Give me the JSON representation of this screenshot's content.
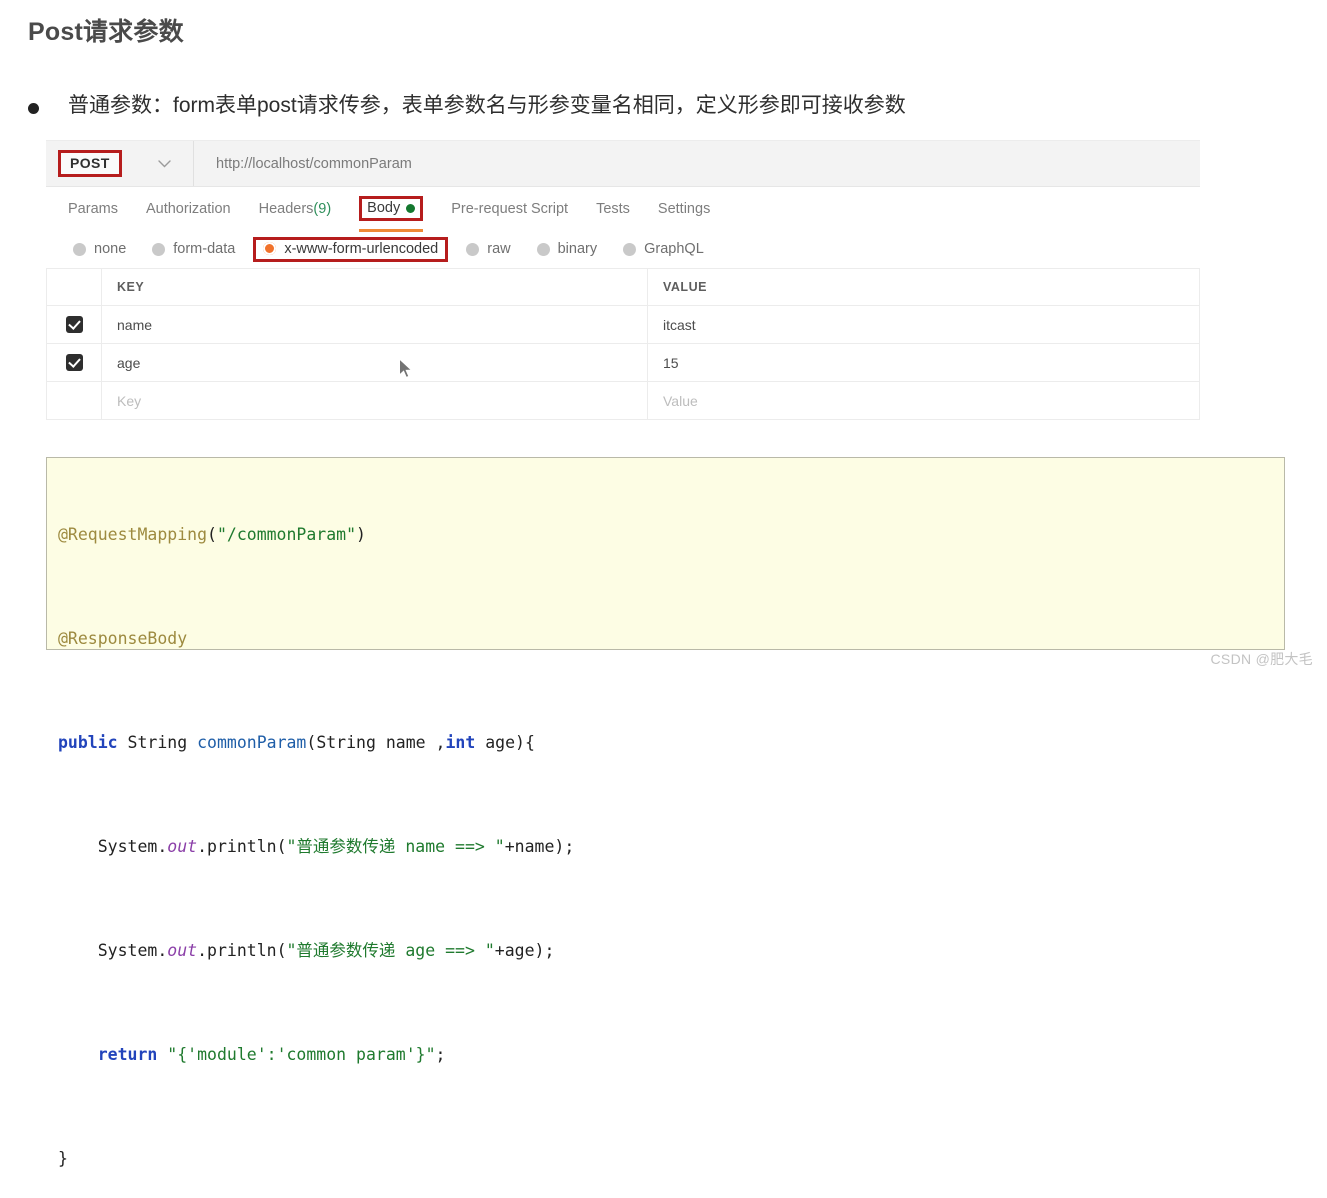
{
  "page": {
    "title": "Post请求参数",
    "bullet": "普通参数：form表单post请求传参，表单参数名与形参变量名相同，定义形参即可接收参数",
    "watermark": "CSDN @肥大毛"
  },
  "postman": {
    "method": "POST",
    "method_caret": "chevron-down",
    "url": "http://localhost/commonParam",
    "tabs": [
      {
        "label": "Params",
        "active": false,
        "boxed": false
      },
      {
        "label": "Authorization",
        "active": false,
        "boxed": false
      },
      {
        "label": "Headers ",
        "count": "(9)",
        "active": false,
        "boxed": false
      },
      {
        "label": "Body",
        "active": true,
        "boxed": true,
        "dot": true
      },
      {
        "label": "Pre-request Script",
        "active": false,
        "boxed": false
      },
      {
        "label": "Tests",
        "active": false,
        "boxed": false
      },
      {
        "label": "Settings",
        "active": false,
        "boxed": false
      }
    ],
    "body_types": [
      {
        "label": "none",
        "selected": false,
        "boxed": false
      },
      {
        "label": "form-data",
        "selected": false,
        "boxed": false
      },
      {
        "label": "x-www-form-urlencoded",
        "selected": true,
        "boxed": true
      },
      {
        "label": "raw",
        "selected": false,
        "boxed": false
      },
      {
        "label": "binary",
        "selected": false,
        "boxed": false
      },
      {
        "label": "GraphQL",
        "selected": false,
        "boxed": false
      }
    ],
    "table": {
      "headers": {
        "key": "KEY",
        "value": "VALUE"
      },
      "rows": [
        {
          "checked": true,
          "key": "name",
          "value": "itcast",
          "placeholder": false
        },
        {
          "checked": true,
          "key": "age",
          "value": "15",
          "placeholder": false
        },
        {
          "checked": false,
          "key": "Key",
          "value": "Value",
          "placeholder": true
        }
      ]
    }
  },
  "code": {
    "lines": [
      {
        "tokens": [
          {
            "t": "@RequestMapping",
            "c": "ann"
          },
          {
            "t": "(",
            "c": "plain"
          },
          {
            "t": "\"/commonParam\"",
            "c": "str"
          },
          {
            "t": ")",
            "c": "plain"
          }
        ]
      },
      {
        "tokens": [
          {
            "t": "@ResponseBody",
            "c": "ann"
          }
        ]
      },
      {
        "tokens": [
          {
            "t": "public",
            "c": "kw"
          },
          {
            "t": " ",
            "c": "plain"
          },
          {
            "t": "String",
            "c": "type"
          },
          {
            "t": " ",
            "c": "plain"
          },
          {
            "t": "commonParam",
            "c": "fn"
          },
          {
            "t": "(",
            "c": "plain"
          },
          {
            "t": "String",
            "c": "type"
          },
          {
            "t": " name ,",
            "c": "plain"
          },
          {
            "t": "int",
            "c": "kw"
          },
          {
            "t": " age){",
            "c": "plain"
          }
        ]
      },
      {
        "tokens": [
          {
            "t": "    System.",
            "c": "plain"
          },
          {
            "t": "out",
            "c": "field"
          },
          {
            "t": ".println(",
            "c": "plain"
          },
          {
            "t": "\"普通参数传递 name ==> \"",
            "c": "str"
          },
          {
            "t": "+name);",
            "c": "plain"
          }
        ]
      },
      {
        "tokens": [
          {
            "t": "    System.",
            "c": "plain"
          },
          {
            "t": "out",
            "c": "field"
          },
          {
            "t": ".println(",
            "c": "plain"
          },
          {
            "t": "\"普通参数传递 age ==> \"",
            "c": "str"
          },
          {
            "t": "+age);",
            "c": "plain"
          }
        ]
      },
      {
        "tokens": [
          {
            "t": "    ",
            "c": "plain"
          },
          {
            "t": "return",
            "c": "kw"
          },
          {
            "t": " ",
            "c": "plain"
          },
          {
            "t": "\"{'module':'common param'}\"",
            "c": "str"
          },
          {
            "t": ";",
            "c": "plain"
          }
        ]
      },
      {
        "tokens": [
          {
            "t": "}",
            "c": "plain"
          }
        ]
      }
    ]
  },
  "colors": {
    "annotation_red": "#b61d1d",
    "selected_orange": "#f1722b",
    "tab_underline": "#f08a36",
    "body_dot_green": "#14782f",
    "code_bg": "#fdfde4"
  }
}
